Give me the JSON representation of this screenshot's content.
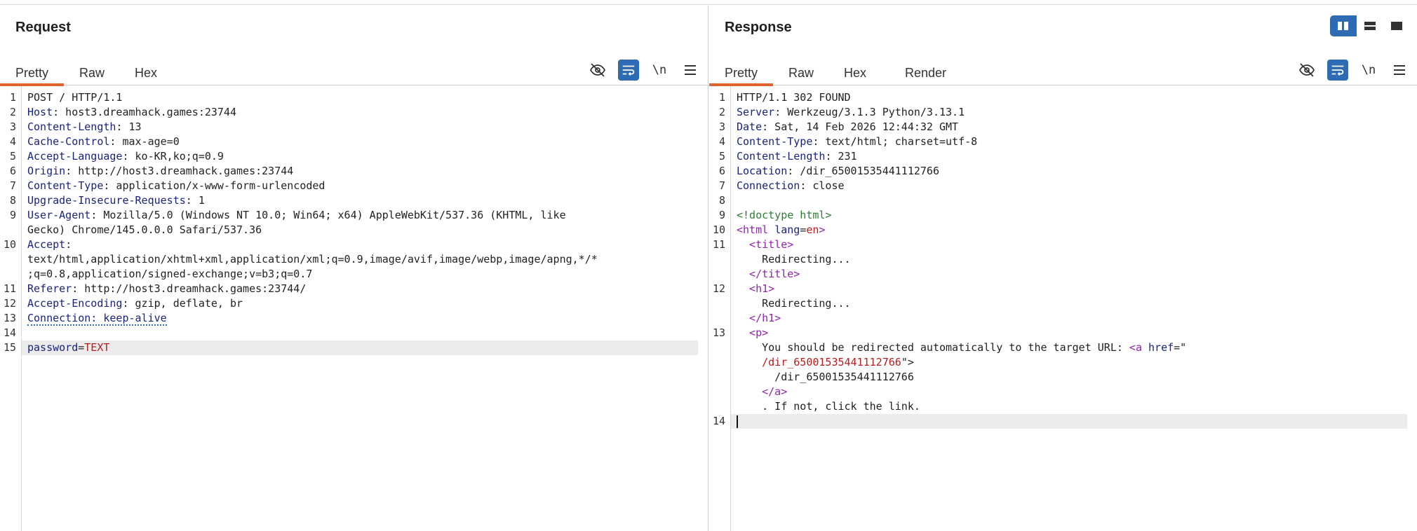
{
  "request": {
    "title": "Request",
    "tabs": [
      "Pretty",
      "Raw",
      "Hex"
    ],
    "active_tab": "Pretty",
    "tools": {
      "hide_icon": "eye-off-icon",
      "wrap_icon": "wrap-icon",
      "newline_label": "\\n",
      "menu_icon": "hamburger-icon"
    },
    "lines": [
      {
        "n": "1",
        "parts": [
          {
            "t": "POST / HTTP/1.1",
            "c": "txt"
          }
        ]
      },
      {
        "n": "2",
        "parts": [
          {
            "t": "Host",
            "c": "hname"
          },
          {
            "t": ": host3.dreamhack.games:23744",
            "c": "hval"
          }
        ]
      },
      {
        "n": "3",
        "parts": [
          {
            "t": "Content-Length",
            "c": "hname"
          },
          {
            "t": ": 13",
            "c": "hval"
          }
        ]
      },
      {
        "n": "4",
        "parts": [
          {
            "t": "Cache-Control",
            "c": "hname"
          },
          {
            "t": ": max-age=0",
            "c": "hval"
          }
        ]
      },
      {
        "n": "5",
        "parts": [
          {
            "t": "Accept-Language",
            "c": "hname"
          },
          {
            "t": ": ko-KR,ko;q=0.9",
            "c": "hval"
          }
        ]
      },
      {
        "n": "6",
        "parts": [
          {
            "t": "Origin",
            "c": "hname"
          },
          {
            "t": ": http://host3.dreamhack.games:23744",
            "c": "hval"
          }
        ]
      },
      {
        "n": "7",
        "parts": [
          {
            "t": "Content-Type",
            "c": "hname"
          },
          {
            "t": ": application/x-www-form-urlencoded",
            "c": "hval"
          }
        ]
      },
      {
        "n": "8",
        "parts": [
          {
            "t": "Upgrade-Insecure-Requests",
            "c": "hname"
          },
          {
            "t": ": 1",
            "c": "hval"
          }
        ]
      },
      {
        "n": "9",
        "parts": [
          {
            "t": "User-Agent",
            "c": "hname"
          },
          {
            "t": ": Mozilla/5.0 (Windows NT 10.0; Win64; x64) AppleWebKit/537.36 (KHTML, like",
            "c": "hval"
          }
        ]
      },
      {
        "n": "",
        "parts": [
          {
            "t": "Gecko) Chrome/145.0.0.0 Safari/537.36",
            "c": "hval"
          }
        ]
      },
      {
        "n": "10",
        "parts": [
          {
            "t": "Accept",
            "c": "hname"
          },
          {
            "t": ":",
            "c": "hval"
          }
        ]
      },
      {
        "n": "",
        "parts": [
          {
            "t": "text/html,application/xhtml+xml,application/xml;q=0.9,image/avif,image/webp,image/apng,*/*",
            "c": "hval"
          }
        ]
      },
      {
        "n": "",
        "parts": [
          {
            "t": ";q=0.8,application/signed-exchange;v=b3;q=0.7",
            "c": "hval"
          }
        ]
      },
      {
        "n": "11",
        "parts": [
          {
            "t": "Referer",
            "c": "hname"
          },
          {
            "t": ": http://host3.dreamhack.games:23744/",
            "c": "hval"
          }
        ]
      },
      {
        "n": "12",
        "parts": [
          {
            "t": "Accept-Encoding",
            "c": "hname"
          },
          {
            "t": ": gzip, deflate, br",
            "c": "hval"
          }
        ]
      },
      {
        "n": "13",
        "parts": [
          {
            "t": "Connection: keep-alive",
            "c": "hname dotted"
          }
        ]
      },
      {
        "n": "14",
        "parts": []
      },
      {
        "n": "15",
        "sel": true,
        "parts": [
          {
            "t": "password",
            "c": "pk"
          },
          {
            "t": "=",
            "c": "hval"
          },
          {
            "t": "TEXT",
            "c": "pv"
          }
        ]
      }
    ]
  },
  "response": {
    "title": "Response",
    "tabs": [
      "Pretty",
      "Raw",
      "Hex",
      "Render"
    ],
    "active_tab": "Pretty",
    "tools": {
      "hide_icon": "eye-off-icon",
      "wrap_icon": "wrap-icon",
      "newline_label": "\\n",
      "menu_icon": "hamburger-icon"
    },
    "lines": [
      {
        "n": "1",
        "parts": [
          {
            "t": "HTTP/1.1 302 FOUND",
            "c": "txt"
          }
        ]
      },
      {
        "n": "2",
        "parts": [
          {
            "t": "Server",
            "c": "hname"
          },
          {
            "t": ": Werkzeug/3.1.3 Python/3.13.1",
            "c": "hval"
          }
        ]
      },
      {
        "n": "3",
        "parts": [
          {
            "t": "Date",
            "c": "hname"
          },
          {
            "t": ": Sat, 14 Feb 2026 12:44:32 GMT",
            "c": "hval"
          }
        ]
      },
      {
        "n": "4",
        "parts": [
          {
            "t": "Content-Type",
            "c": "hname"
          },
          {
            "t": ": text/html; charset=utf-8",
            "c": "hval"
          }
        ]
      },
      {
        "n": "5",
        "parts": [
          {
            "t": "Content-Length",
            "c": "hname"
          },
          {
            "t": ": 231",
            "c": "hval"
          }
        ]
      },
      {
        "n": "6",
        "parts": [
          {
            "t": "Location",
            "c": "hname"
          },
          {
            "t": ": /dir_65001535441112766",
            "c": "hval"
          }
        ]
      },
      {
        "n": "7",
        "parts": [
          {
            "t": "Connection",
            "c": "hname"
          },
          {
            "t": ": close",
            "c": "hval"
          }
        ]
      },
      {
        "n": "8",
        "parts": []
      },
      {
        "n": "9",
        "parts": [
          {
            "t": "<!doctype html>",
            "c": "doctype"
          }
        ]
      },
      {
        "n": "10",
        "parts": [
          {
            "t": "<html ",
            "c": "tag"
          },
          {
            "t": "lang",
            "c": "attr"
          },
          {
            "t": "=",
            "c": "txt"
          },
          {
            "t": "en",
            "c": "aval"
          },
          {
            "t": ">",
            "c": "tag"
          }
        ]
      },
      {
        "n": "11",
        "parts": [
          {
            "t": "  <title>",
            "c": "tag"
          }
        ]
      },
      {
        "n": "",
        "parts": [
          {
            "t": "    Redirecting...",
            "c": "txt"
          }
        ]
      },
      {
        "n": "",
        "parts": [
          {
            "t": "  </title>",
            "c": "tag"
          }
        ]
      },
      {
        "n": "12",
        "parts": [
          {
            "t": "  <h1>",
            "c": "tag"
          }
        ]
      },
      {
        "n": "",
        "parts": [
          {
            "t": "    Redirecting...",
            "c": "txt"
          }
        ]
      },
      {
        "n": "",
        "parts": [
          {
            "t": "  </h1>",
            "c": "tag"
          }
        ]
      },
      {
        "n": "13",
        "parts": [
          {
            "t": "  <p>",
            "c": "tag"
          }
        ]
      },
      {
        "n": "",
        "parts": [
          {
            "t": "    You should be redirected automatically to the target URL: ",
            "c": "txt"
          },
          {
            "t": "<a ",
            "c": "tag"
          },
          {
            "t": "href",
            "c": "attr"
          },
          {
            "t": "=\"",
            "c": "txt"
          }
        ]
      },
      {
        "n": "",
        "parts": [
          {
            "t": "    /dir_65001535441112766",
            "c": "aval"
          },
          {
            "t": "\">",
            "c": "txt"
          }
        ]
      },
      {
        "n": "",
        "parts": [
          {
            "t": "      /dir_65001535441112766",
            "c": "txt"
          }
        ]
      },
      {
        "n": "",
        "parts": [
          {
            "t": "    </a>",
            "c": "tag"
          }
        ]
      },
      {
        "n": "",
        "parts": [
          {
            "t": "    . If not, click the link.",
            "c": "txt"
          }
        ]
      },
      {
        "n": "14",
        "sel": true,
        "caret": true,
        "parts": []
      }
    ]
  },
  "layout_toggles": [
    "split-columns-icon",
    "split-rows-icon",
    "single-pane-icon"
  ]
}
